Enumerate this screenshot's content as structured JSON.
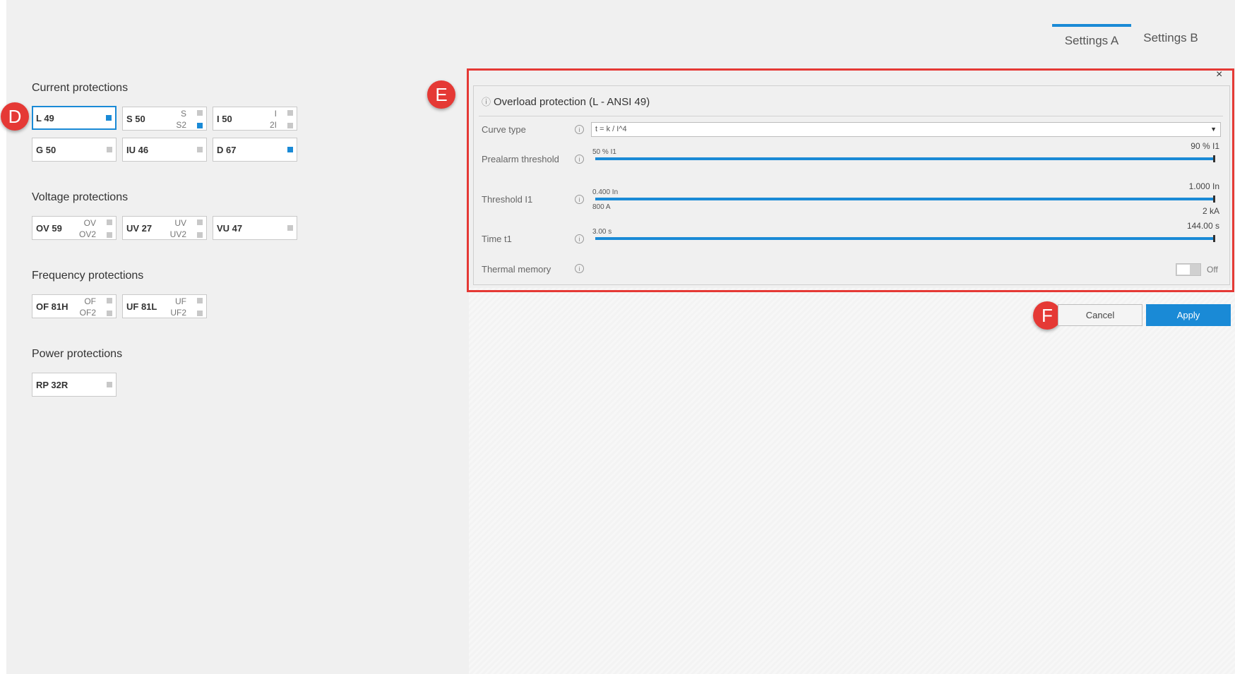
{
  "tabs": {
    "settings_a": "Settings A",
    "settings_b": "Settings B"
  },
  "markers": {
    "d": "D",
    "e": "E",
    "f": "F"
  },
  "sections": {
    "current": {
      "title": "Current protections",
      "items": [
        {
          "name": "L 49"
        },
        {
          "name": "S 50",
          "sub1": "S",
          "sub2": "S2"
        },
        {
          "name": "I 50",
          "sub1": "I",
          "sub2": "2I"
        },
        {
          "name": "G 50"
        },
        {
          "name": "IU 46"
        },
        {
          "name": "D 67"
        }
      ]
    },
    "voltage": {
      "title": "Voltage protections",
      "items": [
        {
          "name": "OV 59",
          "sub1": "OV",
          "sub2": "OV2"
        },
        {
          "name": "UV 27",
          "sub1": "UV",
          "sub2": "UV2"
        },
        {
          "name": "VU 47"
        }
      ]
    },
    "frequency": {
      "title": "Frequency protections",
      "items": [
        {
          "name": "OF 81H",
          "sub1": "OF",
          "sub2": "OF2"
        },
        {
          "name": "UF 81L",
          "sub1": "UF",
          "sub2": "UF2"
        }
      ]
    },
    "power": {
      "title": "Power protections",
      "items": [
        {
          "name": "RP 32R"
        }
      ]
    }
  },
  "dialog": {
    "title": "Overload protection (L - ANSI 49)",
    "close": "×",
    "info_glyph": "i",
    "curve": {
      "label": "Curve type",
      "value": "t = k / I^4",
      "arrow": "▼"
    },
    "prealarm": {
      "label": "Prealarm threshold",
      "min": "50 % I1",
      "value": "90 % I1",
      "fraction": 1.0
    },
    "threshold": {
      "label": "Threshold I1",
      "min": "0.400 In",
      "min2": "800 A",
      "value": "1.000 In",
      "value2": "2 kA",
      "fraction": 1.0
    },
    "time": {
      "label": "Time t1",
      "min": "3.00 s",
      "value": "144.00 s",
      "fraction": 1.0
    },
    "thermal": {
      "label": "Thermal memory",
      "state": "Off"
    }
  },
  "buttons": {
    "cancel": "Cancel",
    "apply": "Apply"
  },
  "colors": {
    "accent": "#1a8ad6",
    "marker": "#e53935",
    "indicator_off": "#c8c8c8"
  }
}
